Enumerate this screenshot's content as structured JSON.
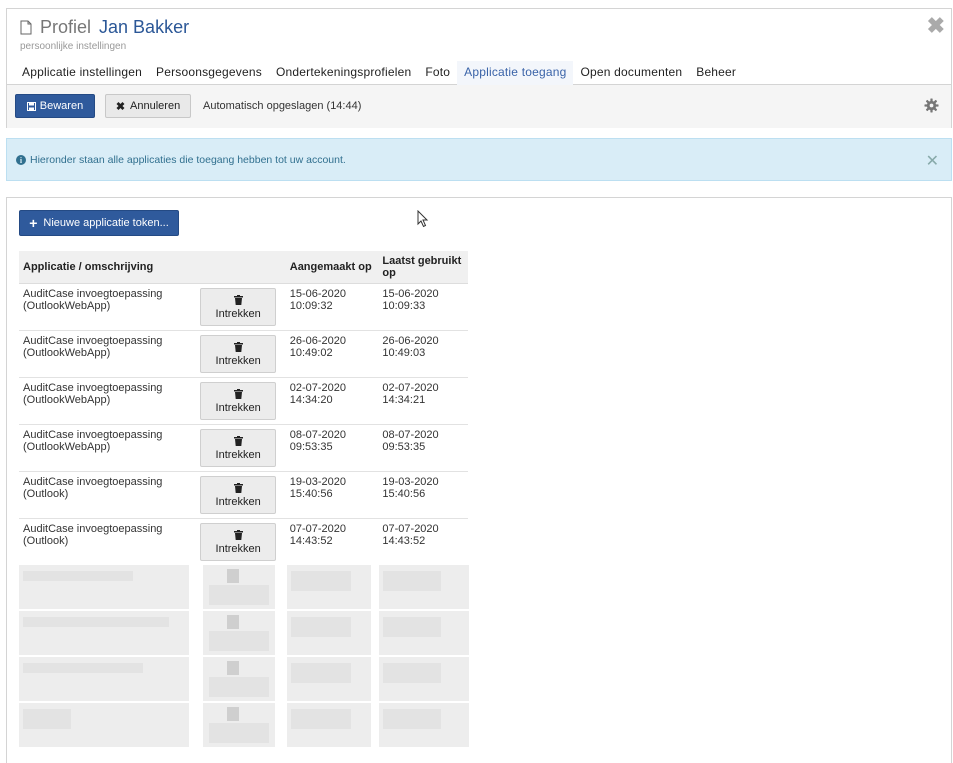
{
  "header": {
    "title_prefix": "Profiel",
    "title_name": "Jan Bakker",
    "subtitle": "persoonlijke instellingen"
  },
  "tabs": [
    {
      "label": "Applicatie instellingen"
    },
    {
      "label": "Persoonsgegevens"
    },
    {
      "label": "Ondertekeningsprofielen"
    },
    {
      "label": "Foto"
    },
    {
      "label": "Applicatie toegang",
      "active": true
    },
    {
      "label": "Open documenten"
    },
    {
      "label": "Beheer"
    }
  ],
  "toolbar": {
    "save_label": "Bewaren",
    "cancel_label": "Annuleren",
    "autosave_text": "Automatisch opgeslagen (14:44)"
  },
  "info": {
    "text": "Hieronder staan alle applicaties die toegang hebben tot uw account."
  },
  "content": {
    "new_token_label": "Nieuwe applicatie token..."
  },
  "table": {
    "headers": {
      "app": "Applicatie / omschrijving",
      "created": "Aangemaakt op",
      "last_used": "Laatst gebruikt op"
    },
    "revoke_label": "Intrekken",
    "rows": [
      {
        "app_line1": "AuditCase invoegtoepassing",
        "app_line2": "(OutlookWebApp)",
        "created_date": "15-06-2020",
        "created_time": "10:09:32",
        "used_date": "15-06-2020",
        "used_time": "10:09:33"
      },
      {
        "app_line1": "AuditCase invoegtoepassing",
        "app_line2": "(OutlookWebApp)",
        "created_date": "26-06-2020",
        "created_time": "10:49:02",
        "used_date": "26-06-2020",
        "used_time": "10:49:03"
      },
      {
        "app_line1": "AuditCase invoegtoepassing",
        "app_line2": "(OutlookWebApp)",
        "created_date": "02-07-2020",
        "created_time": "14:34:20",
        "used_date": "02-07-2020",
        "used_time": "14:34:21"
      },
      {
        "app_line1": "AuditCase invoegtoepassing",
        "app_line2": "(OutlookWebApp)",
        "created_date": "08-07-2020",
        "created_time": "09:53:35",
        "used_date": "08-07-2020",
        "used_time": "09:53:35"
      },
      {
        "app_line1": "AuditCase invoegtoepassing",
        "app_line2": "(Outlook)",
        "created_date": "19-03-2020",
        "created_time": "15:40:56",
        "used_date": "19-03-2020",
        "used_time": "15:40:56"
      },
      {
        "app_line1": "AuditCase invoegtoepassing",
        "app_line2": "(Outlook)",
        "created_date": "07-07-2020",
        "created_time": "14:43:52",
        "used_date": "07-07-2020",
        "used_time": "14:43:52"
      }
    ]
  },
  "colors": {
    "primary": "#2f5a9c",
    "tab_active": "#3a63a8",
    "info_bg": "#d9edf7",
    "info_text": "#31708f"
  },
  "icons": {
    "title": "document-icon",
    "close": "close-icon",
    "save": "floppy-icon",
    "cancel": "times-icon",
    "settings": "gear-icon",
    "info": "info-circle-icon",
    "add": "plus-icon",
    "revoke": "trash-icon"
  }
}
